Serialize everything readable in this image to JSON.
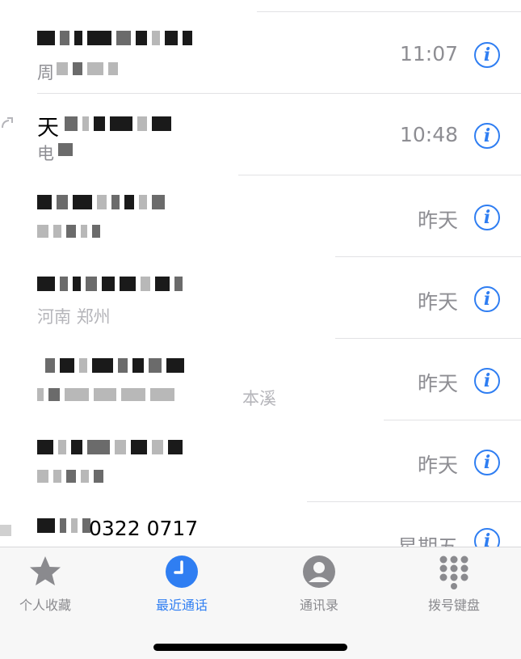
{
  "calls": [
    {
      "name": "",
      "subtitle": "周",
      "time": "11:07",
      "outgoing": false
    },
    {
      "name": "天",
      "subtitle": "电",
      "time": "10:48",
      "outgoing": true
    },
    {
      "name": "",
      "subtitle": "",
      "time": "昨天",
      "outgoing": false
    },
    {
      "name": "",
      "subtitle": "河南 郑州",
      "time": "昨天",
      "outgoing": false
    },
    {
      "name": "",
      "subtitle": "本溪",
      "time": "昨天",
      "outgoing": false
    },
    {
      "name": "",
      "subtitle": "",
      "time": "昨天",
      "outgoing": false
    },
    {
      "name": "0322 0717",
      "subtitle": "",
      "time": "星期五",
      "outgoing": false
    }
  ],
  "info_glyph": "i",
  "tabs": [
    {
      "label": "个人收藏",
      "icon": "star-icon",
      "active": false
    },
    {
      "label": "最近通话",
      "icon": "clock-icon",
      "active": true
    },
    {
      "label": "通讯录",
      "icon": "person-circle-icon",
      "active": false
    },
    {
      "label": "拨号键盘",
      "icon": "keypad-icon",
      "active": false
    }
  ],
  "colors": {
    "accent": "#2f7ef2",
    "secondary_text": "#8e8e93",
    "tabbar_bg": "#f7f7f7"
  }
}
